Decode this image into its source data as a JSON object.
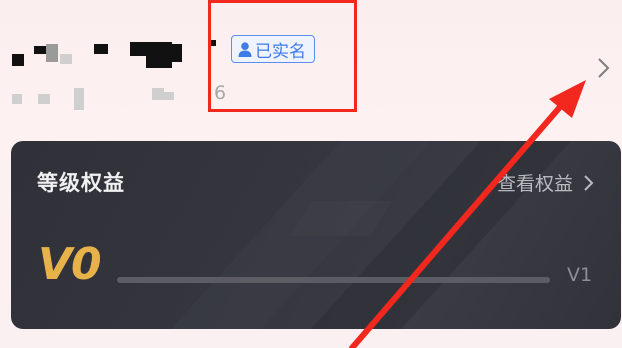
{
  "profile": {
    "id_suffix": "6",
    "verified_label": "已实名"
  },
  "level_card": {
    "title": "等级权益",
    "view_rights_label": "查看权益",
    "current_level": "V0",
    "next_level": "V1",
    "progress_fraction": 0
  },
  "colors": {
    "accent_gold": "#e8b24a",
    "badge_blue": "#3f7be6",
    "highlight_red": "#f2281e"
  },
  "icons": [
    "user-icon",
    "chevron-right-icon",
    "red-arrow-annotation"
  ]
}
